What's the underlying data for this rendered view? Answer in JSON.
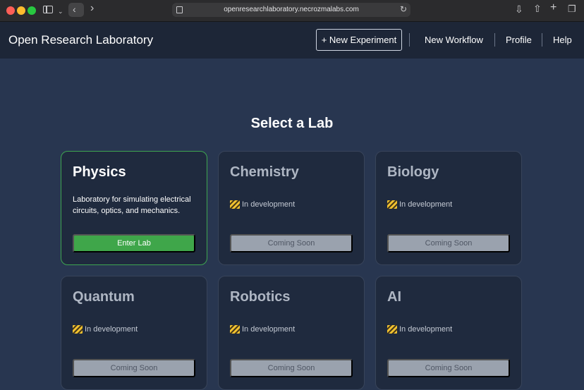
{
  "browser": {
    "url": "openresearchlaboratory.necrozmalabs.com"
  },
  "nav": {
    "app_title": "Open Research Laboratory",
    "new_experiment": "+ New Experiment",
    "new_workflow": "New Workflow",
    "profile": "Profile",
    "help": "Help"
  },
  "main": {
    "heading": "Select a Lab",
    "labs": [
      {
        "title": "Physics",
        "description": "Laboratory for simulating electrical circuits, optics, and mechanics.",
        "button": "Enter Lab"
      },
      {
        "title": "Chemistry",
        "status": "In development",
        "button": "Coming Soon"
      },
      {
        "title": "Biology",
        "status": "In development",
        "button": "Coming Soon"
      },
      {
        "title": "Quantum",
        "status": "In development",
        "button": "Coming Soon"
      },
      {
        "title": "Robotics",
        "status": "In development",
        "button": "Coming Soon"
      },
      {
        "title": "AI",
        "status": "In development",
        "button": "Coming Soon"
      }
    ]
  },
  "colors": {
    "background": "#283650",
    "navbar": "#1d2637",
    "card": "#1f2a3e",
    "accent_green": "#3fa64a",
    "disabled_button": "#9aa2ae"
  }
}
